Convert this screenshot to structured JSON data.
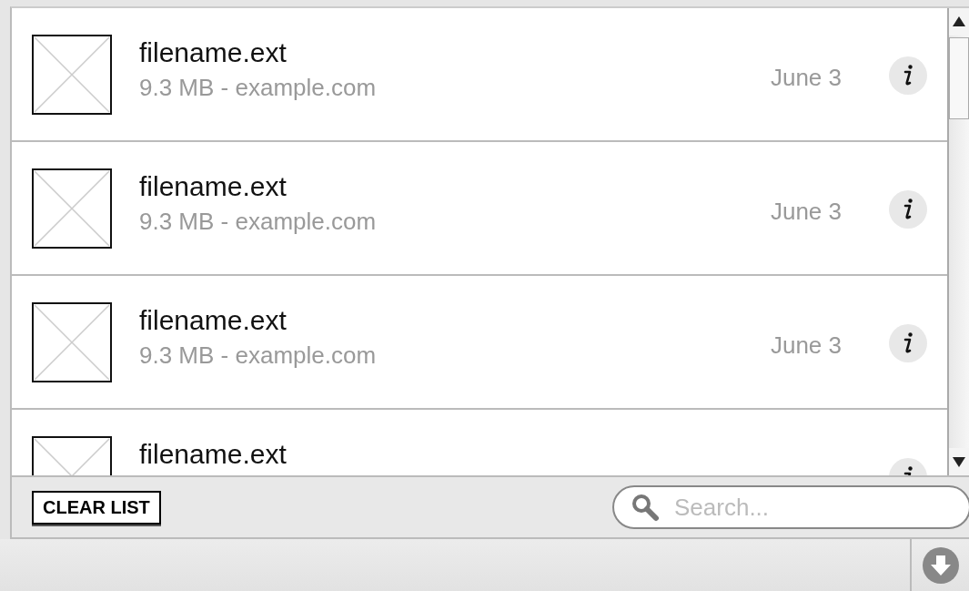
{
  "files": [
    {
      "name": "filename.ext",
      "details": "9.3 MB - example.com",
      "date": "June 3"
    },
    {
      "name": "filename.ext",
      "details": "9.3 MB - example.com",
      "date": "June 3"
    },
    {
      "name": "filename.ext",
      "details": "9.3 MB - example.com",
      "date": "June 3"
    },
    {
      "name": "filename.ext"
    }
  ],
  "clear_button": "CLEAR LIST",
  "search": {
    "placeholder": "Search..."
  }
}
